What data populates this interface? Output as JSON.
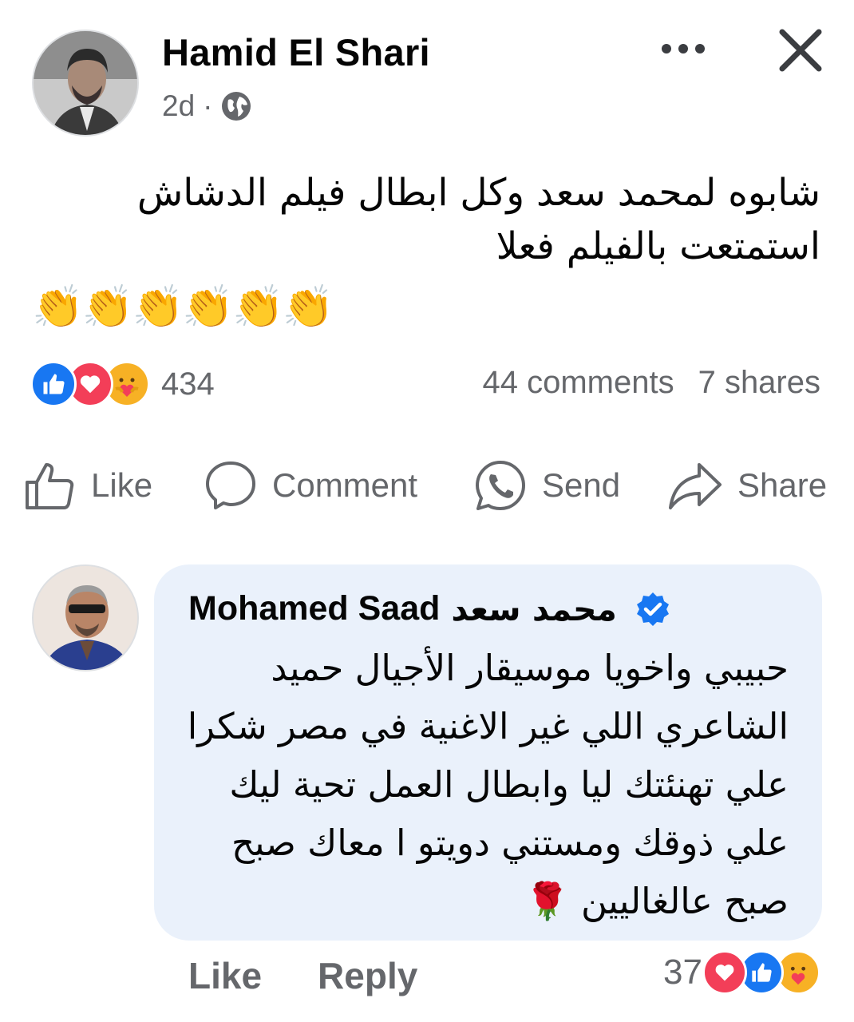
{
  "post": {
    "author": "Hamid El Shari",
    "time": "2d",
    "separator": "·",
    "audience_icon": "globe-icon",
    "text_line_1": "شابوه لمحمد سعد وكل ابطال  فيلم الدشاش",
    "text_line_2": "استمتعت بالفيلم  فعلا",
    "emoji": "👏👏👏👏👏👏",
    "reaction_count": "434",
    "comments": "44 comments",
    "shares": "7 shares"
  },
  "actions": {
    "like": "Like",
    "comment": "Comment",
    "send": "Send",
    "share": "Share"
  },
  "comment": {
    "author": "Mohamed Saad",
    "author_ar": "محمد سعد",
    "lines": [
      "حبيبي واخويا موسيقار الأجيال حميد",
      "الشاعري اللي غير الاغنية في مصر شكرا",
      "علي تهنئتك ليا وابطال العمل تحية ليك",
      "علي ذوقك ومستني دويتو ا معاك صبح",
      "صبح عالغاليين 🌹"
    ],
    "like_label": "Like",
    "reply_label": "Reply",
    "reaction_count": "37"
  },
  "colors": {
    "like_blue": "#1877f2",
    "love_red": "#f33e58",
    "care_yellow": "#f7b125",
    "comment_bubble": "#eaf1fb",
    "muted_text": "#65676b"
  }
}
